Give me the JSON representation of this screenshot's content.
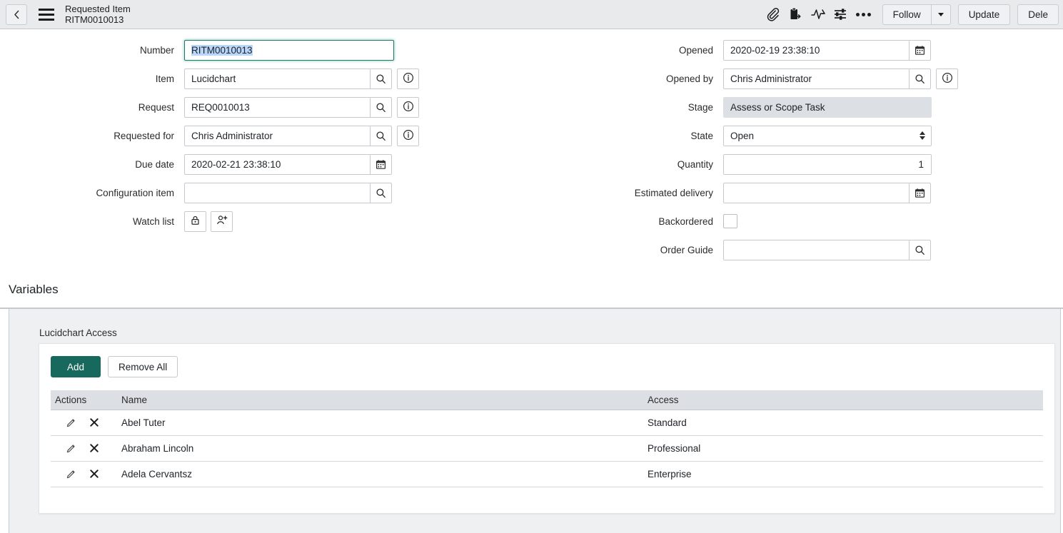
{
  "header": {
    "back_icon": "chevron-left-icon",
    "menu_icon": "hamburger-icon",
    "title": "Requested Item",
    "subtitle": "RITM0010013",
    "icons": [
      {
        "name": "attachment-icon",
        "label": "Attachments"
      },
      {
        "name": "clipboard-export-icon",
        "label": "Template"
      },
      {
        "name": "activity-icon",
        "label": "Activity"
      },
      {
        "name": "sliders-icon",
        "label": "Personalize"
      },
      {
        "name": "more-options-icon",
        "label": "More options"
      }
    ],
    "follow_label": "Follow",
    "follow_caret_icon": "chevron-down-icon",
    "update_label": "Update",
    "delete_label": "Dele"
  },
  "form": {
    "left": {
      "number_label": "Number",
      "number_value": "RITM0010013",
      "item_label": "Item",
      "item_value": "Lucidchart",
      "request_label": "Request",
      "request_value": "REQ0010013",
      "requested_for_label": "Requested for",
      "requested_for_value": "Chris Administrator",
      "due_date_label": "Due date",
      "due_date_value": "2020-02-21 23:38:10",
      "configuration_item_label": "Configuration item",
      "configuration_item_value": "",
      "watch_list_label": "Watch list"
    },
    "right": {
      "opened_label": "Opened",
      "opened_value": "2020-02-19 23:38:10",
      "opened_by_label": "Opened by",
      "opened_by_value": "Chris Administrator",
      "stage_label": "Stage",
      "stage_value": "Assess or Scope Task",
      "state_label": "State",
      "state_value": "Open",
      "quantity_label": "Quantity",
      "quantity_value": "1",
      "estimated_delivery_label": "Estimated delivery",
      "estimated_delivery_value": "",
      "backordered_label": "Backordered",
      "order_guide_label": "Order Guide",
      "order_guide_value": ""
    }
  },
  "variables": {
    "section_title": "Variables",
    "panel_label": "Lucidchart Access",
    "add_label": "Add",
    "remove_all_label": "Remove All",
    "columns": [
      "Actions",
      "Name",
      "Access"
    ],
    "rows": [
      {
        "name": "Abel Tuter",
        "access": "Standard"
      },
      {
        "name": "Abraham Lincoln",
        "access": "Professional"
      },
      {
        "name": "Adela Cervantsz",
        "access": "Enterprise"
      }
    ]
  },
  "colors": {
    "accent_green": "#16695c",
    "focus_border": "#1c7a6a",
    "selection": "#b9d6fb",
    "header_bg": "#e8eaec",
    "panel_bg": "#eef0f2",
    "table_header_bg": "#dcdfe3"
  }
}
